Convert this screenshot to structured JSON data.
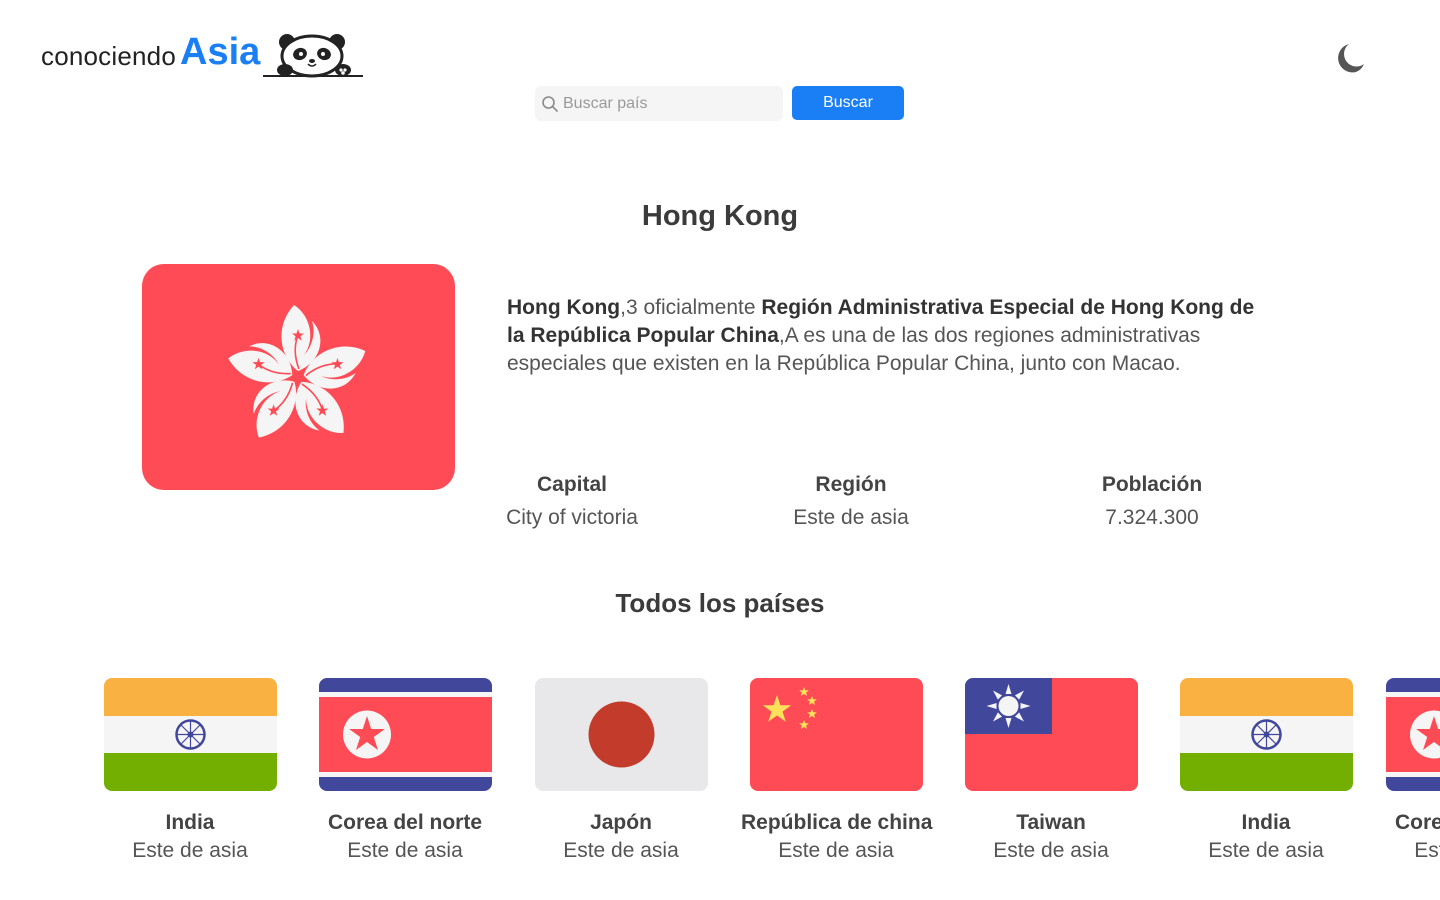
{
  "header": {
    "logo_prefix": "conociendo",
    "logo_main": "Asia",
    "logo_icon": "panda-icon",
    "theme_icon": "moon-icon"
  },
  "search": {
    "placeholder": "Buscar país",
    "value": "",
    "button_label": "Buscar",
    "icon": "search-icon"
  },
  "country": {
    "title": "Hong Kong",
    "flag": "hong-kong-flag",
    "description": {
      "name": "Hong Kong",
      "sup1": ",3",
      "text1": " oficialmente ",
      "official_name": "Región Administrativa Especial de Hong Kong de la República Popular China",
      "sup2": ",A",
      "text2": " es una de las dos regiones administrativas especiales que existen en la República Popular China, junto con Macao."
    },
    "stats": {
      "capital_label": "Capital",
      "capital_value": "City of victoria",
      "region_label": "Región",
      "region_value": "Este de asia",
      "population_label": "Población",
      "population_value": "7.324.300"
    }
  },
  "all_countries": {
    "title": "Todos los países",
    "items": [
      {
        "name": "India",
        "region": "Este de asia",
        "flag": "india-flag"
      },
      {
        "name": "Corea del norte",
        "region": "Este de asia",
        "flag": "north-korea-flag"
      },
      {
        "name": "Japón",
        "region": "Este de asia",
        "flag": "japan-flag"
      },
      {
        "name": "República de china",
        "region": "Este de asia",
        "flag": "china-flag"
      },
      {
        "name": "Taiwan",
        "region": "Este de asia",
        "flag": "taiwan-flag"
      },
      {
        "name": "India",
        "region": "Este de asia",
        "flag": "india-flag"
      },
      {
        "name": "Corea del norte",
        "region": "Este de asia",
        "flag": "north-korea-flag"
      }
    ]
  },
  "colors": {
    "accent": "#1a7ef5",
    "flag_red": "#ff4b55",
    "india_saffron": "#f9b242",
    "india_green": "#73af00",
    "korea_blue": "#41479b",
    "japan_red": "#c23b2b",
    "china_yellow": "#ffe15a"
  }
}
